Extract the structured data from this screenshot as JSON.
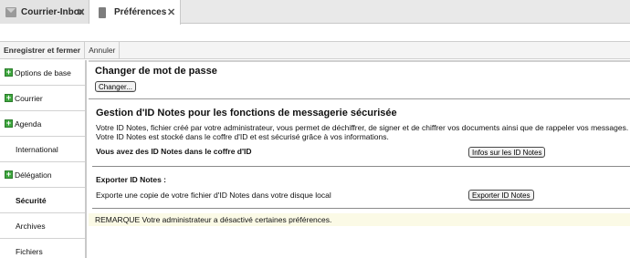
{
  "tabs": [
    {
      "label": "Courrier-Inbox",
      "icon": "envelope-icon",
      "close": "✕"
    },
    {
      "label": "Préférences",
      "icon": "document-icon",
      "close": "✕"
    }
  ],
  "toolbar": {
    "save_close_label": "Enregistrer et fermer",
    "cancel_label": "Annuler"
  },
  "sidebar": {
    "items": [
      {
        "label": "Options de base",
        "expandable": true,
        "expand_glyph": "+"
      },
      {
        "label": "Courrier",
        "expandable": true,
        "expand_glyph": "+"
      },
      {
        "label": "Agenda",
        "expandable": true,
        "expand_glyph": "+"
      },
      {
        "label": "International",
        "expandable": false
      },
      {
        "label": "Délégation",
        "expandable": true,
        "expand_glyph": "+"
      },
      {
        "label": "Sécurité",
        "expandable": false,
        "selected": true
      },
      {
        "label": "Archives",
        "expandable": false
      },
      {
        "label": "Fichiers",
        "expandable": false
      }
    ]
  },
  "main": {
    "password_heading": "Changer de mot de passe",
    "change_button": "Changer...",
    "id_heading": "Gestion d'ID Notes pour les fonctions de messagerie sécurisée",
    "id_description": "Votre ID Notes, fichier créé par votre administrateur, vous permet de déchiffrer, de signer et de chiffrer vos documents ainsi que de rappeler vos messages. Votre ID Notes est stocké dans le coffre d'ID et est sécurisé grâce à vos informations.",
    "vault_label": "Vous avez des ID Notes dans le coffre d'ID",
    "vault_button": "Infos sur les ID Notes",
    "export_heading": "Exporter ID Notes :",
    "export_desc": "Exporte une copie de votre fichier d'ID Notes dans votre disque local",
    "export_button": "Exporter ID Notes",
    "note": "REMARQUE Votre administrateur a désactivé certaines préférences."
  },
  "colors": {
    "expand_icon": "#3ea63e",
    "note_background": "#fbfae6",
    "tabbar_background": "#e9e9e9"
  }
}
